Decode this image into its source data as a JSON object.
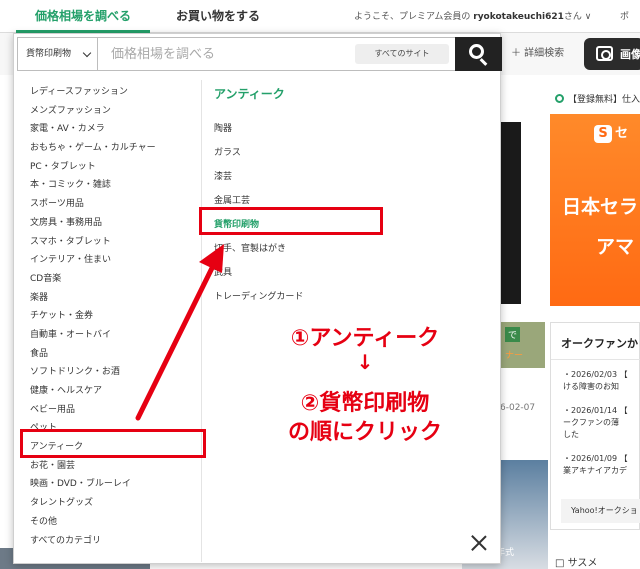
{
  "topnav": {
    "tab_price": "価格相場を調べる",
    "tab_shop": "お買い物をする",
    "welcome_prefix": "ようこそ、プレミアム会員の",
    "username": "ryokotakeuchi621",
    "welcome_suffix": "さん ∨",
    "extra": "ポ"
  },
  "search": {
    "category": "貨幣印刷物",
    "placeholder": "価格相場を調べる",
    "site": "すべてのサイト",
    "adv_search": "＋ 詳細検索",
    "image_search": "画像"
  },
  "categories": [
    "レディースファッション",
    "メンズファッション",
    "家電・AV・カメラ",
    "おもちゃ・ゲーム・カルチャー",
    "PC・タブレット",
    "本・コミック・雑誌",
    "スポーツ用品",
    "文房具・事務用品",
    "スマホ・タブレット",
    "インテリア・住まい",
    "CD音楽",
    "楽器",
    "チケット・金券",
    "自動車・オートバイ",
    "食品",
    "ソフトドリンク・お酒",
    "健康・ヘルスケア",
    "ベビー用品",
    "ペット",
    "アンティーク",
    "お花・園芸",
    "映画・DVD・ブルーレイ",
    "タレントグッズ",
    "その他",
    "すべてのカテゴリ"
  ],
  "subcategory": {
    "title": "アンティーク",
    "items": [
      "陶器",
      "ガラス",
      "漆芸",
      "金属工芸",
      "貨幣印刷物",
      "切手、官製はがき",
      "武具",
      "トレーディングカード"
    ],
    "active_index": 4
  },
  "annotation": {
    "step1": "①アンティーク",
    "arrow": "↓",
    "step2": "②貨幣印刷物",
    "step3": "の順にクリック"
  },
  "right_panel": {
    "free_reg": "【登録無料】仕入",
    "ad_logo": "セ",
    "ad_line1": "日本セラ",
    "ad_line2": "アマ",
    "ofan_title": "オークファンか",
    "news": [
      {
        "line1": "・2026/02/03 【",
        "line2": "ける障害のお知"
      },
      {
        "line1": "・2026/01/14 【",
        "line2": "ークファンの薄",
        "line3": "した"
      },
      {
        "line1": "・2026/01/09 【",
        "line2": "業アキナイアカデ"
      }
    ],
    "yahoo_link": "Yahoo!オークショ",
    "bottom": "□ サスメ"
  },
  "background": {
    "tag1": "で",
    "tag2": "ナー",
    "date": "6-02-07",
    "tag3": "年式"
  },
  "colors": {
    "accent": "#24a06a",
    "annotation": "#e60012",
    "ad_orange": "#ff6a13"
  }
}
